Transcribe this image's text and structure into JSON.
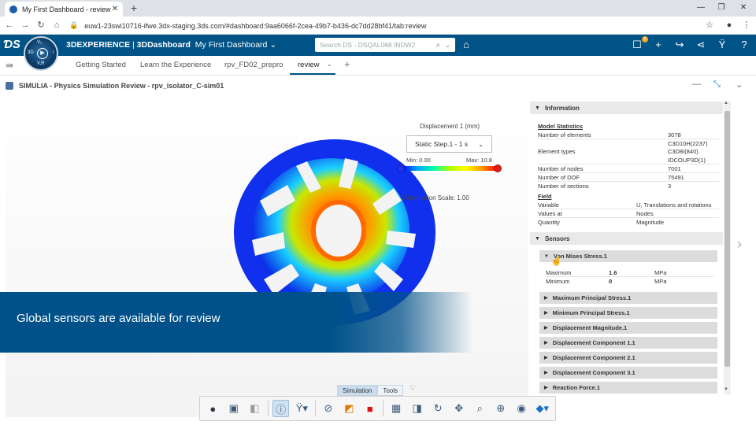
{
  "browser": {
    "tab_title": "My First Dashboard - review",
    "url": "euw1-23swi10716-ifwe.3dx-staging.3ds.com/#dashboard:9aa6066f-2cea-49b7-b436-dc7dd28bf41/tab:review"
  },
  "topbar": {
    "brand_bold": "3DEXPERIENCE",
    "brand_app": "3DDashboard",
    "dashboard_name": "My First Dashboard",
    "search_placeholder": "Search DS - DSQAL068 INDW2",
    "notification_count": "5",
    "compass": {
      "top": "V₁",
      "left": "3D",
      "right": "i",
      "bottom": "V,R"
    }
  },
  "tabs": [
    {
      "label": "Getting Started"
    },
    {
      "label": "Learn the Experience"
    },
    {
      "label": "rpv_FD02_prepro"
    },
    {
      "label": "review"
    }
  ],
  "app": {
    "title": "SIMULIA - Physics Simulation Review - rpv_isolator_C-sim01"
  },
  "viewport": {
    "result_label": "Displacement 1 (mm)",
    "step": "Static Step.1 - 1 s",
    "colorbar_min": "Min: 0.00",
    "colorbar_max": "Max: 10.8",
    "deformation_scale": "Deformation Scale: 1.00"
  },
  "banner": {
    "text": "Global sensors are available for review"
  },
  "toolbar": {
    "tabs": [
      "Simulation",
      "Tools"
    ],
    "icons": [
      "sphere-icon",
      "cube-box-icon",
      "camera-icon",
      "info-icon",
      "axis-icon",
      "hide-icon",
      "gradient-icon",
      "color-legend-icon",
      "mesh-icon",
      "section-icon",
      "rotate-icon",
      "pan-icon",
      "zoom-area-icon",
      "zoom-icon",
      "view-icon",
      "view-cube-icon"
    ]
  },
  "panel": {
    "information_header": "Information",
    "model_statistics_label": "Model Statistics",
    "stats": [
      {
        "key": "Number of elements",
        "value": "3078"
      },
      {
        "key": "Element types",
        "value": "C3D10H(2237)"
      },
      {
        "key": "",
        "value": "C3D8I(840)"
      },
      {
        "key": "",
        "value": "IDCOUP3D(1)"
      },
      {
        "key": "Number of nodes",
        "value": "7001"
      },
      {
        "key": "Number of DOF",
        "value": "75491"
      },
      {
        "key": "Number of sections",
        "value": "3"
      }
    ],
    "field_label": "Field",
    "field": [
      {
        "key": "Variable",
        "value": "U, Translations and rotations"
      },
      {
        "key": "Values at",
        "value": "Nodes"
      },
      {
        "key": "Quantity",
        "value": "Magnitude"
      }
    ],
    "sensors_header": "Sensors",
    "sensor_open": {
      "name": "Von Mises Stress.1",
      "rows": [
        {
          "key": "Maximum",
          "value": "1.6",
          "unit": "MPa"
        },
        {
          "key": "Minimum",
          "value": "0",
          "unit": "MPa"
        }
      ]
    },
    "sensors_closed": [
      "Maximum Principal Stress.1",
      "Minimum Principal Stress.1",
      "Displacement Magnitude.1",
      "Displacement Component 1.1",
      "Displacement Component 2.1",
      "Displacement Component 3.1",
      "Reaction Force.1"
    ]
  },
  "colors": {
    "brand_blue": "#005386",
    "banner_blue": "#00518a"
  }
}
